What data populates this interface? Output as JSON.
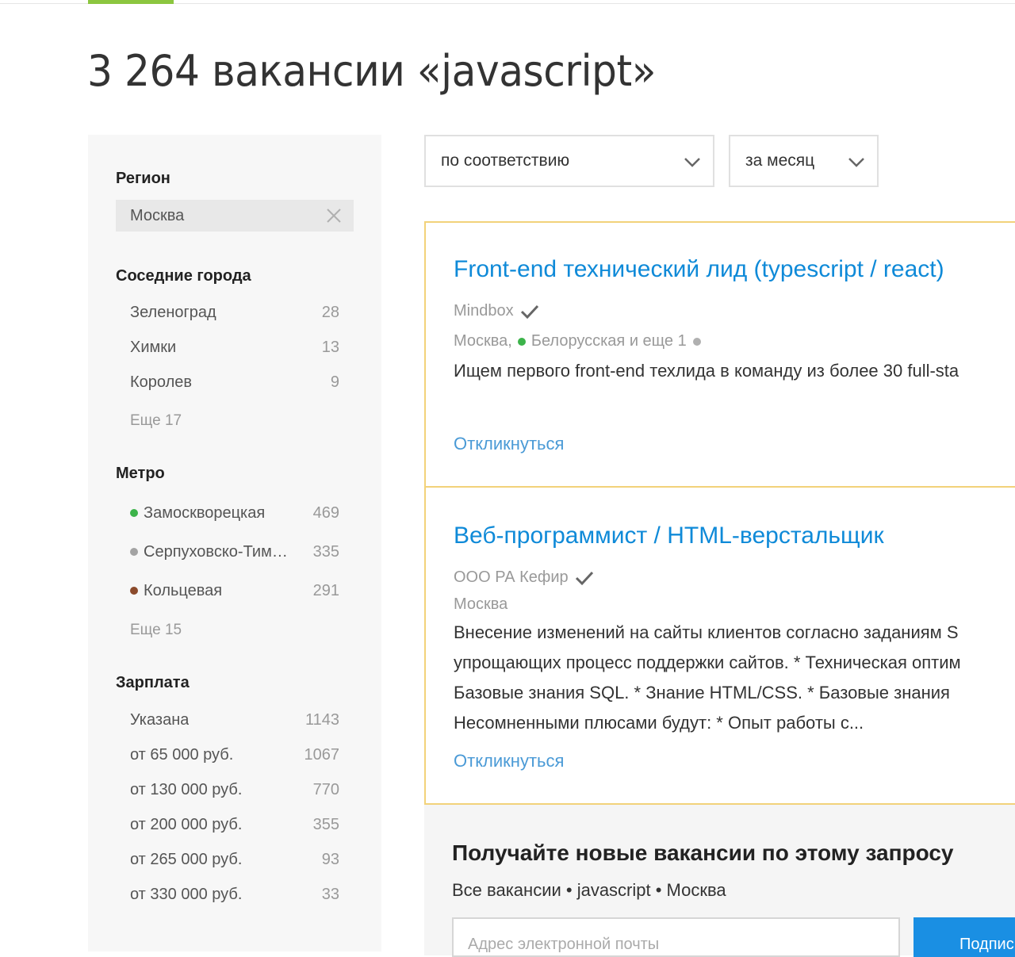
{
  "page": {
    "title": "3 264 вакансии «javascript»"
  },
  "colors": {
    "accent_green": "#8cc63f",
    "link_blue": "#0f8ad8",
    "card_border": "#f2d27a"
  },
  "sidebar": {
    "region": {
      "heading": "Регион",
      "selected": "Москва",
      "clear_icon": "close-icon"
    },
    "nearby": {
      "heading": "Соседние города",
      "items": [
        {
          "label": "Зеленоград",
          "count": "28"
        },
        {
          "label": "Химки",
          "count": "13"
        },
        {
          "label": "Королев",
          "count": "9"
        }
      ],
      "more": "Еще 17"
    },
    "metro": {
      "heading": "Метро",
      "items": [
        {
          "label": "Замоскворецкая",
          "count": "469",
          "color": "#3cb34a"
        },
        {
          "label": "Серпуховско-Тим…",
          "count": "335",
          "color": "#a3a3a3"
        },
        {
          "label": "Кольцевая",
          "count": "291",
          "color": "#8b4a2b"
        }
      ],
      "more": "Еще 15"
    },
    "salary": {
      "heading": "Зарплата",
      "items": [
        {
          "label": "Указана",
          "count": "1143"
        },
        {
          "label": "от 65 000 руб.",
          "count": "1067"
        },
        {
          "label": "от 130 000 руб.",
          "count": "770"
        },
        {
          "label": "от 200 000 руб.",
          "count": "355"
        },
        {
          "label": "от 265 000 руб.",
          "count": "93"
        },
        {
          "label": "от 330 000 руб.",
          "count": "33"
        }
      ]
    }
  },
  "sort": {
    "order": "по соответствию",
    "period": "за месяц"
  },
  "vacancies": [
    {
      "title": "Front-end технический лид (typescript / react)",
      "company": "Mindbox",
      "city": "Москва,",
      "metro": "Белорусская и еще 1",
      "metro_color": "#3cb34a",
      "snippet": [
        "Ищем первого front-end техлида в команду из более 30 full-sta"
      ],
      "respond": "Откликнуться"
    },
    {
      "title": "Веб-программист / HTML-верстальщик",
      "company": "ООО РА Кефир",
      "city": "Москва",
      "snippet": [
        "Внесение изменений на сайты клиентов согласно заданиям S",
        "упрощающих процесс поддержки сайтов. * Техническая оптим",
        "Базовые знания SQL. * Знание HTML/CSS. * Базовые знания",
        "Несомненными плюсами будут: * Опыт работы с..."
      ],
      "respond": "Откликнуться"
    }
  ],
  "subscribe": {
    "title": "Получайте новые вакансии по этому запросу",
    "query": "Все вакансии • javascript • Москва",
    "email_placeholder": "Адрес электронной почты",
    "button": "Подпис"
  }
}
